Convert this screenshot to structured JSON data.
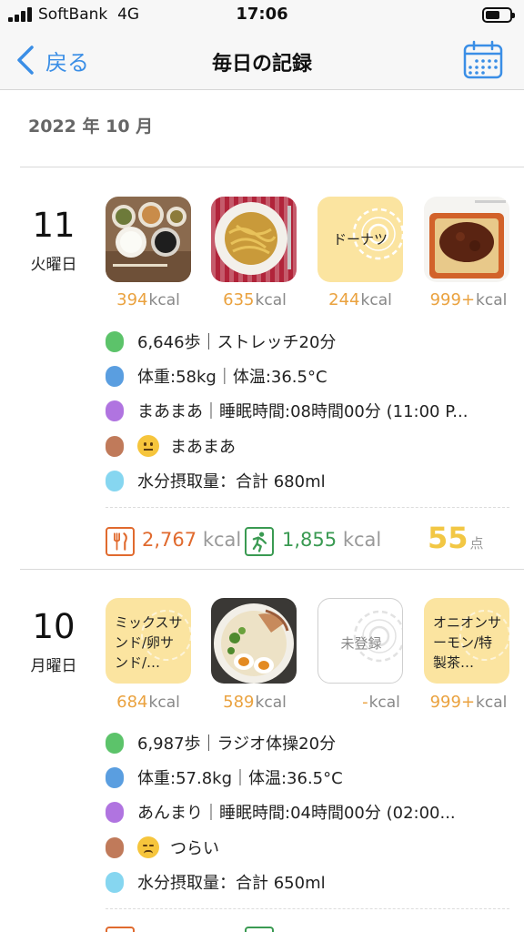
{
  "status_bar": {
    "carrier": "SoftBank",
    "network": "4G",
    "time": "17:06"
  },
  "nav": {
    "back_label": "戻る",
    "title": "毎日の記録"
  },
  "month_header": "2022 年 10 月",
  "days": [
    {
      "day_number": "11",
      "weekday": "火曜日",
      "meals": [
        {
          "type": "photo",
          "description": "teishoku",
          "kcal": "394",
          "unit": "kcal"
        },
        {
          "type": "photo",
          "description": "spaghetti",
          "kcal": "635",
          "unit": "kcal"
        },
        {
          "type": "placeholder",
          "label": "ドーナツ",
          "kcal": "244",
          "unit": "kcal"
        },
        {
          "type": "photo",
          "description": "meat-sauce",
          "kcal": "999+",
          "unit": "kcal"
        }
      ],
      "activity": "6,646歩｜ストレッチ20分",
      "body": "体重:58kg｜体温:36.5°C",
      "sleep": "まあまあ｜睡眠時間:08時間00分 (11:00 P...",
      "mood": "まあまあ",
      "water": "水分摂取量：合計 680ml",
      "intake_kcal": "2,767",
      "burned_kcal": "1,855",
      "kcal_unit": "kcal",
      "score": "55",
      "score_unit": "点"
    },
    {
      "day_number": "10",
      "weekday": "月曜日",
      "meals": [
        {
          "type": "placeholder",
          "label": "ミックスサンド/卵サンド/…",
          "kcal": "684",
          "unit": "kcal"
        },
        {
          "type": "photo",
          "description": "ramen",
          "kcal": "589",
          "unit": "kcal"
        },
        {
          "type": "empty",
          "label": "未登録",
          "kcal": "-",
          "unit": "kcal"
        },
        {
          "type": "placeholder",
          "label": "オニオンサーモン/特製茶…",
          "kcal": "999+",
          "unit": "kcal"
        }
      ],
      "activity": "6,987歩｜ラジオ体操20分",
      "body": "体重:57.8kg｜体温:36.5°C",
      "sleep": "あんまり｜睡眠時間:04時間00分 (02:00...",
      "mood": "つらい",
      "water": "水分摂取量：合計 650ml"
    }
  ],
  "colors": {
    "accent": "#3a8ee6",
    "kcal": "#eaa23f",
    "intake": "#e06a2e",
    "burned": "#3a9a52",
    "score": "#f2c744",
    "dot_activity": "#5cc36a",
    "dot_body": "#5a9ee0",
    "dot_sleep": "#b074e0",
    "dot_mood": "#c07a5a",
    "dot_water": "#86d6f0",
    "placeholder_bg": "#fbe4a0"
  }
}
